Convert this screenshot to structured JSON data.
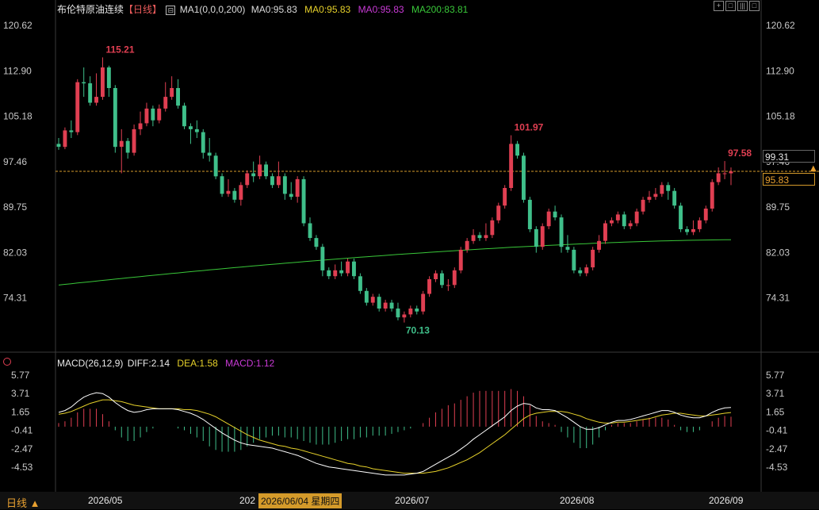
{
  "header": {
    "symbol": "布伦特原油连续",
    "period_tag": "【日线】",
    "ma_settings": "MA1(0,0,0,200)",
    "ma0_label": "MA0:95.83",
    "ma0_yellow": "MA0:95.83",
    "ma0_magenta": "MA0:95.83",
    "ma200_label": "MA200:83.81"
  },
  "toolbar": {
    "btn1": "+",
    "btn2": "□",
    "btn3": "|||",
    "btn4": "□"
  },
  "price_axis": [
    "120.62",
    "112.90",
    "105.18",
    "97.46",
    "89.75",
    "82.03",
    "74.31"
  ],
  "macd_axis": [
    "5.77",
    "3.71",
    "1.65",
    "-0.41",
    "-2.47",
    "-4.53"
  ],
  "price_markers": {
    "current": "99.31",
    "ma0": "95.83"
  },
  "macd_header": {
    "name": "MACD(26,12,9)",
    "diff": "DIFF:2.14",
    "dea": "DEA:1.58",
    "macd": "MACD:1.12"
  },
  "footer": {
    "period": "日线",
    "dates": [
      "2026/05",
      "202",
      "2026/06/04 星期四",
      "2026/07",
      "2026/08",
      "2026/09"
    ]
  },
  "colors": {
    "up": "#e03f52",
    "down": "#3fbf8a",
    "ma200": "#39c739",
    "diff": "#ffffff",
    "dea": "#e6d12a",
    "macd_label": "#c93ad6",
    "ref_line": "#d49a2a"
  },
  "chart_data": {
    "type": "candlestick",
    "price_range": [
      69.0,
      122.0
    ],
    "macd_range": [
      -5.5,
      6.2
    ],
    "annotations": [
      {
        "label": "115.21",
        "index": 7
      },
      {
        "label": "101.97",
        "index": 72
      },
      {
        "label": "70.13",
        "index": 55
      },
      {
        "label": "97.58",
        "index": 106
      }
    ],
    "candles": [
      [
        100.5,
        100.0,
        101.5,
        99.5
      ],
      [
        100.0,
        102.8,
        103.3,
        99.6
      ],
      [
        102.8,
        102.5,
        104.5,
        101.5
      ],
      [
        102.5,
        111.0,
        111.5,
        102.0
      ],
      [
        111.0,
        110.8,
        113.5,
        108.5
      ],
      [
        110.8,
        107.5,
        112.0,
        107.0
      ],
      [
        107.5,
        108.5,
        112.5,
        107.0
      ],
      [
        108.5,
        113.5,
        115.21,
        108.0
      ],
      [
        113.5,
        110.0,
        113.8,
        108.5
      ],
      [
        110.0,
        100.0,
        110.5,
        99.0
      ],
      [
        100.0,
        101.0,
        103.0,
        95.5
      ],
      [
        101.0,
        99.0,
        101.5,
        98.0
      ],
      [
        99.0,
        103.0,
        103.8,
        98.5
      ],
      [
        103.0,
        104.0,
        106.0,
        102.0
      ],
      [
        104.0,
        106.5,
        107.5,
        103.5
      ],
      [
        106.5,
        104.5,
        107.0,
        103.5
      ],
      [
        104.5,
        106.5,
        107.2,
        104.0
      ],
      [
        106.5,
        108.5,
        111.0,
        106.0
      ],
      [
        108.5,
        110.0,
        112.0,
        108.0
      ],
      [
        110.0,
        107.0,
        111.5,
        106.5
      ],
      [
        107.0,
        103.5,
        107.5,
        103.0
      ],
      [
        103.5,
        103.0,
        104.0,
        100.5
      ],
      [
        103.0,
        102.5,
        104.5,
        101.5
      ],
      [
        102.5,
        99.0,
        103.0,
        98.0
      ],
      [
        99.0,
        98.5,
        101.5,
        97.5
      ],
      [
        98.5,
        95.0,
        99.0,
        94.5
      ],
      [
        95.0,
        92.0,
        95.5,
        91.5
      ],
      [
        92.0,
        92.5,
        94.5,
        91.5
      ],
      [
        92.5,
        91.0,
        93.0,
        90.5
      ],
      [
        91.0,
        93.5,
        94.0,
        90.0
      ],
      [
        93.5,
        95.5,
        96.0,
        93.0
      ],
      [
        95.5,
        95.0,
        97.5,
        94.0
      ],
      [
        95.0,
        97.0,
        98.5,
        94.5
      ],
      [
        97.0,
        95.0,
        97.5,
        94.5
      ],
      [
        95.0,
        93.5,
        95.5,
        93.0
      ],
      [
        93.5,
        95.0,
        97.5,
        93.0
      ],
      [
        95.0,
        92.0,
        95.5,
        91.0
      ],
      [
        92.0,
        91.5,
        94.0,
        91.0
      ],
      [
        91.5,
        94.5,
        95.0,
        90.5
      ],
      [
        94.5,
        87.0,
        95.0,
        86.5
      ],
      [
        87.0,
        84.5,
        88.0,
        84.0
      ],
      [
        84.5,
        83.0,
        85.0,
        82.5
      ],
      [
        83.0,
        79.0,
        83.5,
        78.0
      ],
      [
        79.0,
        78.0,
        79.5,
        77.5
      ],
      [
        78.0,
        79.0,
        80.0,
        77.5
      ],
      [
        79.0,
        78.5,
        80.5,
        78.0
      ],
      [
        78.5,
        80.5,
        81.0,
        78.0
      ],
      [
        80.5,
        78.0,
        81.0,
        77.5
      ],
      [
        78.0,
        75.5,
        78.5,
        75.0
      ],
      [
        75.5,
        73.5,
        76.0,
        73.0
      ],
      [
        73.5,
        74.5,
        75.0,
        73.0
      ],
      [
        74.5,
        72.5,
        75.0,
        72.0
      ],
      [
        72.5,
        73.5,
        74.0,
        72.0
      ],
      [
        73.5,
        72.5,
        74.0,
        72.0
      ],
      [
        72.5,
        71.0,
        73.5,
        70.5
      ],
      [
        71.0,
        71.5,
        72.0,
        70.13
      ],
      [
        71.5,
        72.5,
        73.0,
        71.0
      ],
      [
        72.5,
        72.0,
        73.0,
        71.5
      ],
      [
        72.0,
        75.0,
        75.5,
        71.5
      ],
      [
        75.0,
        77.5,
        78.0,
        74.5
      ],
      [
        77.5,
        78.5,
        79.0,
        77.0
      ],
      [
        78.5,
        76.5,
        79.0,
        76.0
      ],
      [
        76.5,
        76.5,
        77.5,
        75.5
      ],
      [
        76.5,
        79.0,
        79.5,
        76.0
      ],
      [
        79.0,
        82.5,
        83.0,
        78.5
      ],
      [
        82.5,
        84.0,
        84.5,
        82.0
      ],
      [
        84.0,
        85.0,
        86.0,
        83.5
      ],
      [
        85.0,
        84.5,
        85.5,
        84.0
      ],
      [
        84.5,
        85.0,
        87.0,
        84.0
      ],
      [
        85.0,
        87.5,
        88.0,
        84.5
      ],
      [
        87.5,
        90.0,
        90.5,
        87.0
      ],
      [
        90.0,
        93.0,
        93.5,
        89.5
      ],
      [
        93.0,
        100.5,
        101.97,
        92.5
      ],
      [
        100.5,
        98.5,
        101.0,
        98.0
      ],
      [
        98.5,
        91.0,
        99.0,
        90.5
      ],
      [
        91.0,
        86.0,
        91.5,
        85.5
      ],
      [
        86.0,
        83.0,
        86.5,
        82.0
      ],
      [
        83.0,
        86.5,
        87.0,
        82.5
      ],
      [
        86.5,
        89.0,
        89.5,
        86.0
      ],
      [
        89.0,
        88.0,
        90.0,
        87.5
      ],
      [
        88.0,
        83.0,
        88.5,
        82.0
      ],
      [
        83.0,
        82.5,
        85.0,
        82.0
      ],
      [
        82.5,
        79.0,
        83.0,
        78.5
      ],
      [
        79.0,
        78.5,
        79.5,
        78.0
      ],
      [
        78.5,
        79.5,
        80.0,
        78.0
      ],
      [
        79.5,
        82.5,
        83.0,
        79.0
      ],
      [
        82.5,
        84.0,
        85.0,
        82.0
      ],
      [
        84.0,
        87.0,
        87.5,
        83.5
      ],
      [
        87.0,
        87.5,
        88.0,
        86.5
      ],
      [
        87.5,
        88.5,
        89.0,
        87.0
      ],
      [
        88.5,
        86.5,
        89.0,
        86.0
      ],
      [
        86.5,
        87.0,
        87.5,
        86.0
      ],
      [
        87.0,
        89.0,
        89.5,
        86.5
      ],
      [
        89.0,
        91.0,
        91.5,
        88.5
      ],
      [
        91.0,
        91.5,
        92.5,
        90.5
      ],
      [
        91.5,
        92.0,
        93.0,
        91.0
      ],
      [
        92.0,
        93.5,
        94.0,
        91.5
      ],
      [
        93.5,
        92.5,
        94.0,
        91.0
      ],
      [
        92.5,
        90.0,
        93.0,
        89.5
      ],
      [
        90.0,
        86.0,
        90.5,
        85.5
      ],
      [
        86.0,
        85.5,
        86.5,
        85.0
      ],
      [
        85.5,
        86.0,
        87.5,
        85.0
      ],
      [
        86.0,
        87.5,
        88.0,
        85.5
      ],
      [
        87.5,
        89.5,
        90.0,
        87.0
      ],
      [
        89.5,
        94.0,
        94.5,
        89.0
      ],
      [
        94.0,
        95.5,
        96.5,
        93.5
      ],
      [
        95.5,
        95.5,
        97.58,
        94.5
      ],
      [
        95.5,
        95.83,
        96.5,
        93.5
      ]
    ],
    "ma200": {
      "start_index": 0,
      "values_start": 76.5,
      "values_end": 84.2
    },
    "macd": {
      "diff": [
        1.6,
        1.8,
        2.2,
        2.8,
        3.3,
        3.6,
        3.8,
        3.7,
        3.3,
        2.7,
        2.2,
        1.8,
        1.6,
        1.7,
        1.9,
        2.0,
        2.0,
        2.0,
        2.0,
        1.9,
        1.7,
        1.5,
        1.2,
        0.8,
        0.3,
        -0.2,
        -0.7,
        -1.1,
        -1.5,
        -1.8,
        -2.0,
        -2.1,
        -2.2,
        -2.3,
        -2.4,
        -2.6,
        -2.8,
        -3.0,
        -3.2,
        -3.5,
        -3.8,
        -4.1,
        -4.3,
        -4.5,
        -4.6,
        -4.7,
        -4.8,
        -4.9,
        -5.0,
        -5.1,
        -5.2,
        -5.3,
        -5.4,
        -5.4,
        -5.4,
        -5.4,
        -5.3,
        -5.2,
        -5.0,
        -4.6,
        -4.2,
        -3.8,
        -3.4,
        -3.0,
        -2.5,
        -2.0,
        -1.4,
        -0.9,
        -0.4,
        0.1,
        0.6,
        1.1,
        1.8,
        2.3,
        2.6,
        2.5,
        2.1,
        1.9,
        1.9,
        1.8,
        1.4,
        1.0,
        0.5,
        0.0,
        -0.3,
        -0.3,
        -0.1,
        0.2,
        0.5,
        0.7,
        0.7,
        0.8,
        1.0,
        1.2,
        1.4,
        1.6,
        1.8,
        1.8,
        1.6,
        1.3,
        1.1,
        1.0,
        1.0,
        1.2,
        1.6,
        1.9,
        2.1,
        2.14
      ],
      "dea": [
        1.4,
        1.5,
        1.7,
        2.0,
        2.3,
        2.6,
        2.8,
        3.0,
        3.0,
        2.9,
        2.8,
        2.6,
        2.4,
        2.3,
        2.2,
        2.1,
        2.0,
        2.0,
        2.0,
        2.0,
        1.9,
        1.9,
        1.8,
        1.6,
        1.4,
        1.1,
        0.7,
        0.3,
        -0.1,
        -0.5,
        -0.9,
        -1.2,
        -1.5,
        -1.7,
        -1.9,
        -2.1,
        -2.2,
        -2.4,
        -2.5,
        -2.7,
        -2.9,
        -3.1,
        -3.3,
        -3.5,
        -3.7,
        -3.9,
        -4.1,
        -4.2,
        -4.4,
        -4.5,
        -4.7,
        -4.8,
        -4.9,
        -5.0,
        -5.1,
        -5.2,
        -5.2,
        -5.2,
        -5.2,
        -5.1,
        -5.0,
        -4.8,
        -4.6,
        -4.3,
        -4.0,
        -3.7,
        -3.3,
        -2.9,
        -2.4,
        -1.9,
        -1.4,
        -0.9,
        -0.3,
        0.3,
        0.9,
        1.3,
        1.5,
        1.6,
        1.7,
        1.7,
        1.7,
        1.6,
        1.4,
        1.2,
        0.9,
        0.7,
        0.5,
        0.4,
        0.4,
        0.5,
        0.5,
        0.6,
        0.7,
        0.8,
        0.9,
        1.1,
        1.3,
        1.4,
        1.5,
        1.5,
        1.4,
        1.3,
        1.2,
        1.2,
        1.3,
        1.4,
        1.5,
        1.58
      ]
    }
  }
}
